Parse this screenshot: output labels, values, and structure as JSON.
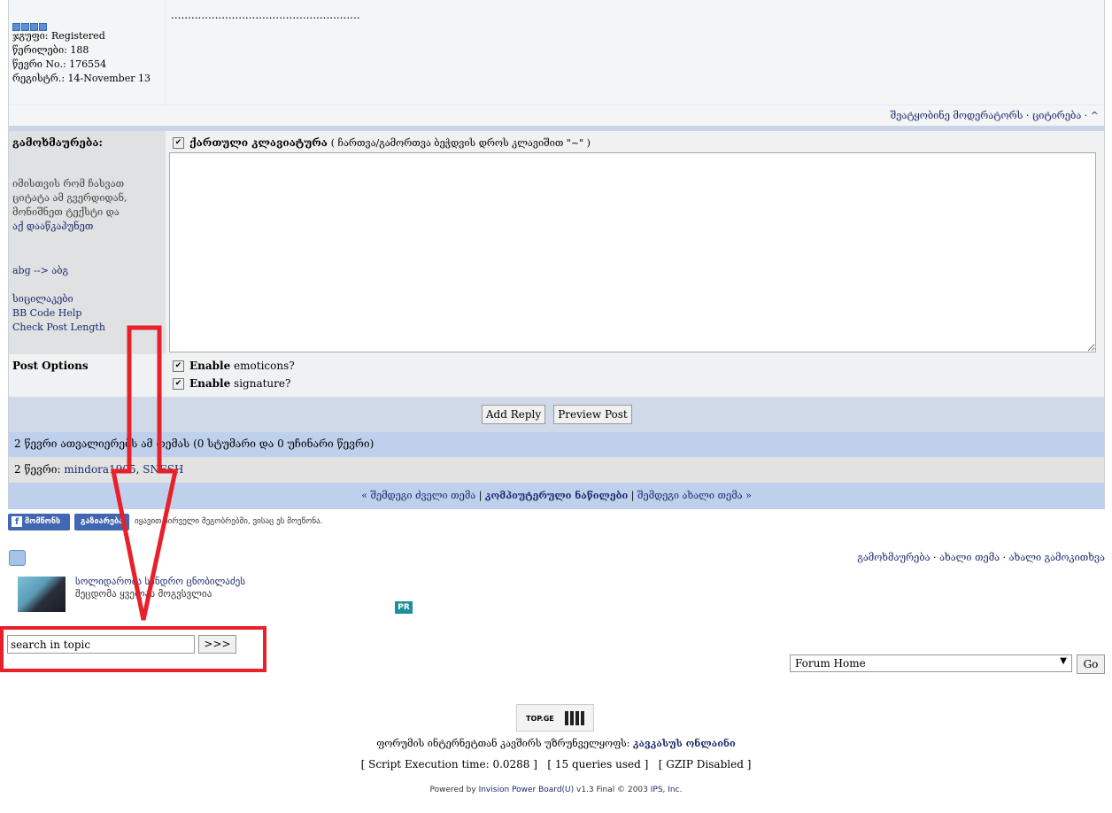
{
  "post": {
    "dots": "........................................................",
    "group": "ჯგუფი: Registered",
    "posts": "წერილები: 188",
    "member_no": "წევრი No.: 176554",
    "registered": "რეგისტრ.: 14-November 13",
    "actions": {
      "report": "შეატყობინე მოდერატორს",
      "sep1": " · ",
      "quote": "ციტირება",
      "sep2": " · ",
      "top": "^"
    }
  },
  "reply": {
    "label": "გამოხმაურება:",
    "hint": "იმისთვის რომ ჩასვათ ციტატა ამ გვერდიდან, მონიშნეთ ტექსტი და",
    "hint_link": "აქ დააწკაპუნეთ",
    "abg": "abg --> აბგ",
    "smilies": "სიცილაკები",
    "bbcode": "BB Code Help",
    "check": "Check Post Length",
    "keyboard_label": "ქართული კლავიატურა",
    "keyboard_hint": "( ჩართვა/გამორთვა ბეჭდვის დროს კლავიშით \"~\" )",
    "textarea": ""
  },
  "options": {
    "label": "Post Options",
    "emoticons_bold": "Enable",
    "emoticons": " emoticons?",
    "signature_bold": "Enable",
    "signature": " signature?"
  },
  "buttons": {
    "add_reply": "Add Reply",
    "preview": "Preview Post"
  },
  "viewers": {
    "summary": "2 წევრი ათვალიერებს ამ თემას (0 სტუმარი და 0 უჩინარი წევრი)",
    "members_prefix": "2 წევრი: ",
    "members": [
      "mindora1905",
      "SNESH"
    ]
  },
  "nav": {
    "older": "« შემდეგი ძველი თემა",
    "forum": "კომპიუტერული ნაწილები",
    "newer": "შემდეგი ახალი თემა »"
  },
  "social": {
    "like": "მომწონს",
    "share": "გაზიარება",
    "text": "იყავით პირველი მეგობრებში, ვისაც ეს მოეწონა."
  },
  "topic_actions": {
    "reply": "გამოხმაურება",
    "new_topic": "ახალი თემა",
    "new_poll": "ახალი გამოკითხვა",
    "sep": " · "
  },
  "news": {
    "line1": "სოლიდარობა სანდრო ცნობილაძეს",
    "line2": "შეცდომა ყველას მოგვსვლია",
    "badge": "PR"
  },
  "search": {
    "value": "search in topic",
    "button": ">>>"
  },
  "jump": {
    "selected": "Forum Home",
    "go": "Go"
  },
  "footer": {
    "counter": "TOP.GE",
    "provider_prefix": "ფორუმის ინტერნეტთან კავშირს უზრუნველყოფს: ",
    "provider": "კავკასუს ონლაინი",
    "exec": "[ Script Execution time: 0.0288 ]",
    "queries": "[ 15 queries used ]",
    "gzip": "[ GZIP Disabled ]",
    "powered_prefix": "Powered by ",
    "powered_link": "Invision Power Board(U)",
    "powered_suffix": " v1.3 Final © 2003  ",
    "ips": "IPS, Inc."
  },
  "colors": {
    "annotation": "#e8202a",
    "row_blue": "#bfd0ec",
    "row_gray": "#e2e2e2"
  }
}
